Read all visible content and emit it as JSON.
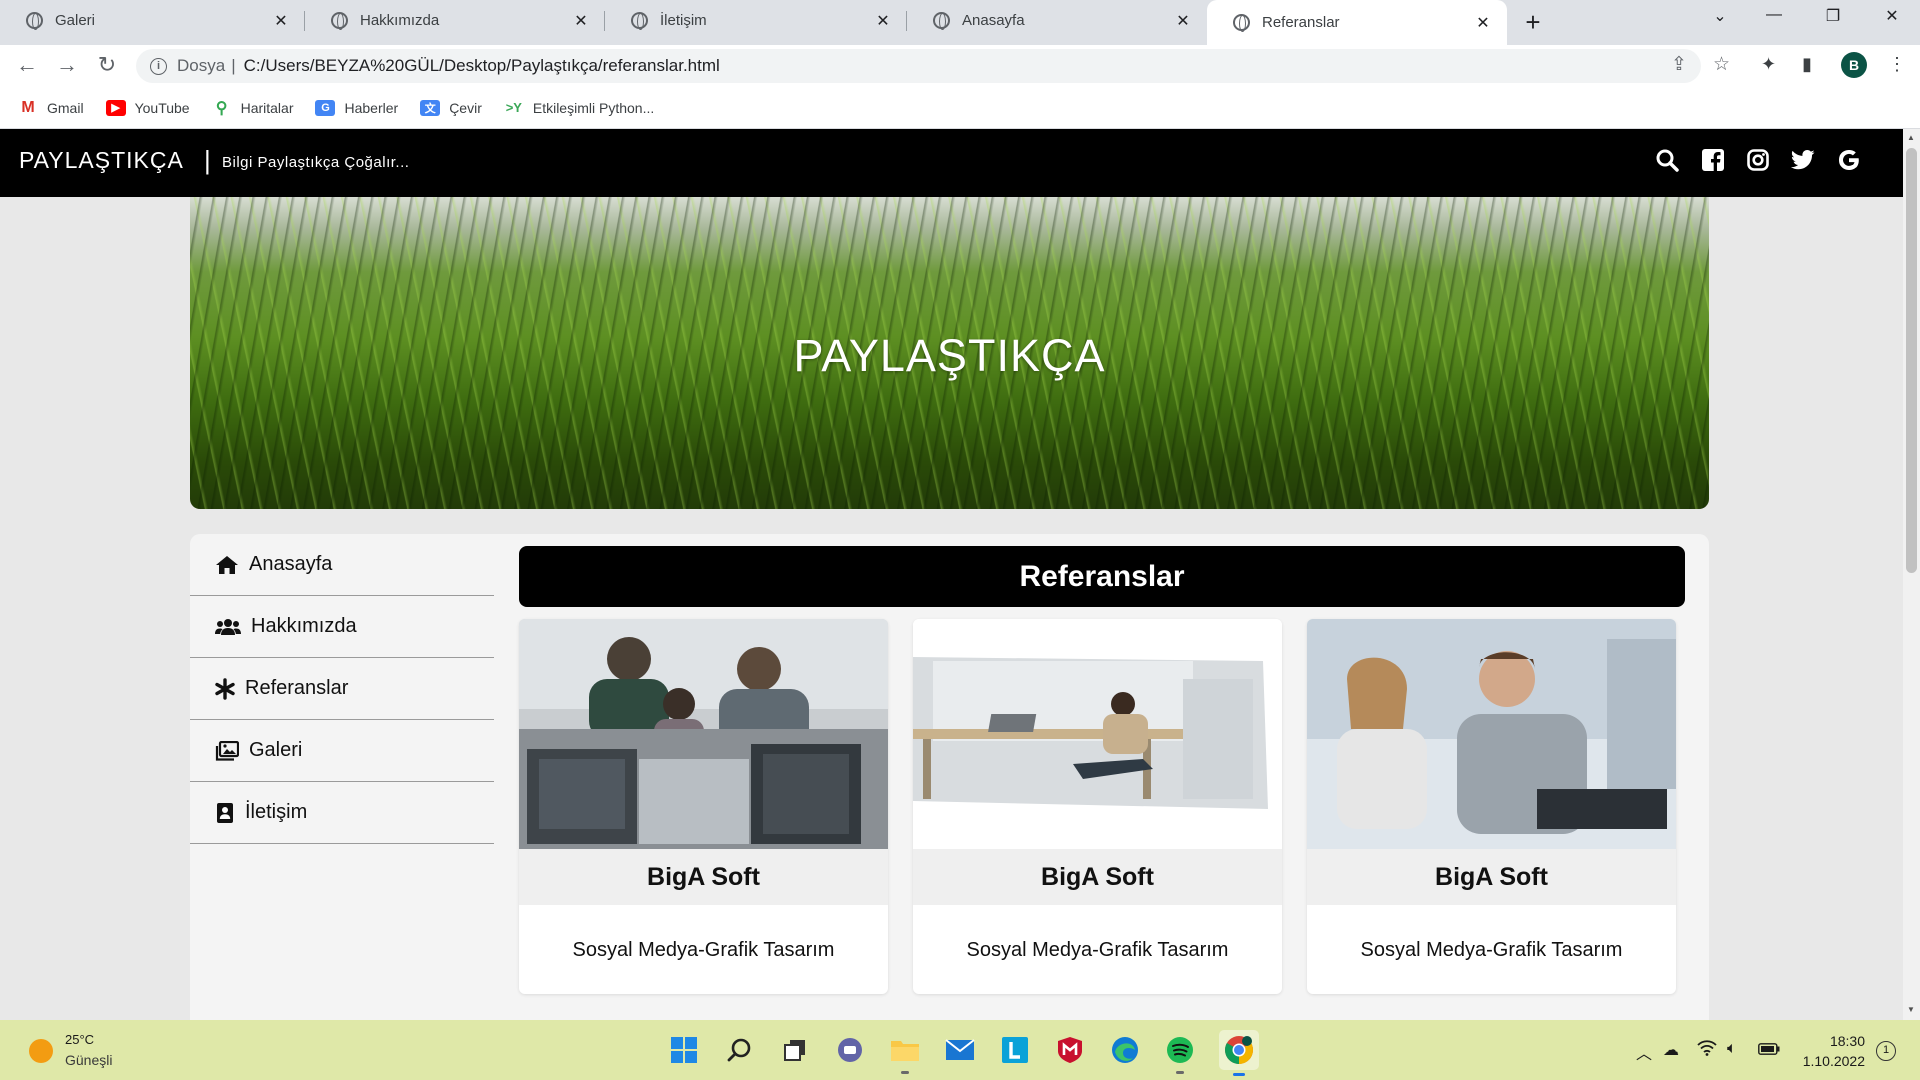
{
  "browser": {
    "tabs": [
      {
        "label": "Galeri"
      },
      {
        "label": "Hakkımızda"
      },
      {
        "label": "İletişim"
      },
      {
        "label": "Anasayfa"
      },
      {
        "label": "Referanslar",
        "active": true
      }
    ],
    "address": {
      "scheme_label": "Dosya",
      "url": "C:/Users/BEYZA%20GÜL/Desktop/Paylaştıkça/referanslar.html"
    },
    "profile_initial": "B",
    "bookmarks": [
      {
        "label": "Gmail",
        "icon": "gmail-icon"
      },
      {
        "label": "YouTube",
        "icon": "youtube-icon"
      },
      {
        "label": "Haritalar",
        "icon": "maps-icon"
      },
      {
        "label": "Haberler",
        "icon": "news-icon"
      },
      {
        "label": "Çevir",
        "icon": "translate-icon"
      },
      {
        "label": "Etkileşimli Python...",
        "icon": "python-icon"
      }
    ]
  },
  "site": {
    "brand": "PAYLAŞTIKÇA",
    "brand_separator": "|",
    "tagline": "Bilgi Paylaştıkça Çoğalır...",
    "social_icons": [
      "search-icon",
      "facebook-icon",
      "instagram-icon",
      "twitter-icon",
      "google-icon"
    ],
    "hero_title": "PAYLAŞTIKÇA",
    "menu": [
      {
        "label": "Anasayfa",
        "icon": "home-icon"
      },
      {
        "label": "Hakkımızda",
        "icon": "users-icon"
      },
      {
        "label": "Referanslar",
        "icon": "asterisk-icon"
      },
      {
        "label": "Galeri",
        "icon": "images-icon"
      },
      {
        "label": "İletişim",
        "icon": "address-book-icon"
      }
    ],
    "section_title": "Referanslar",
    "cards": [
      {
        "name": "BigA Soft",
        "description": "Sosyal Medya-Grafik Tasarım"
      },
      {
        "name": "BigA Soft",
        "description": "Sosyal Medya-Grafik Tasarım"
      },
      {
        "name": "BigA Soft",
        "description": "Sosyal Medya-Grafik Tasarım"
      }
    ]
  },
  "taskbar": {
    "weather_temp": "25°C",
    "weather_condition": "Güneşli",
    "time": "18:30",
    "date": "1.10.2022",
    "notification_count": "1"
  },
  "colors": {
    "header_bg": "#000000",
    "page_bg": "#e8e8e8",
    "content_bg": "#f4f4f4",
    "taskbar_bg": "#dfe8a8"
  }
}
